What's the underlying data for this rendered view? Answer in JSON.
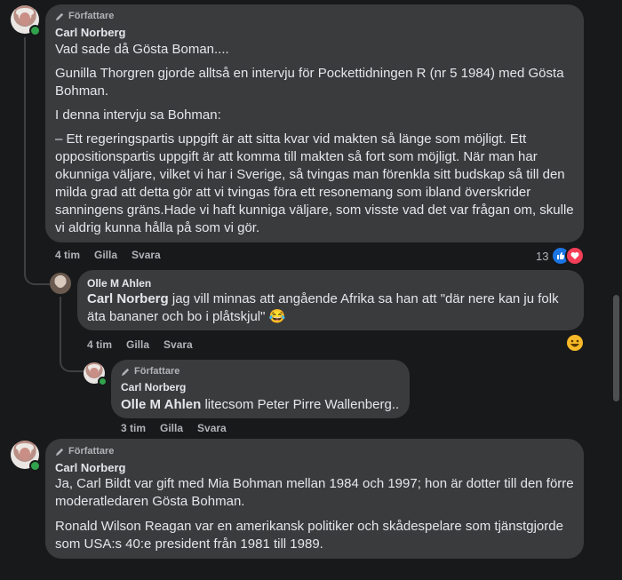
{
  "comments": [
    {
      "badge": "Författare",
      "author": "Carl Norberg",
      "paragraphs": [
        "Vad sade då Gösta Boman....",
        "Gunilla Thorgren gjorde alltså en intervju för Pockettidningen R (nr 5 1984) med Gösta Bohman.",
        "I denna intervju sa Bohman:",
        "– Ett regeringspartis uppgift är att sitta kvar vid makten så länge som möjligt. Ett oppositionspartis uppgift är att komma till makten så fort som möjligt. När man har okunniga väljare, vilket vi har i Sverige, så tvingas man förenkla sitt budskap så till den milda grad att detta gör att vi tvingas föra ett resonemang som ibland överskrider sanningens gräns.Hade vi haft kunniga väljare, som visste vad det var frågan om, skulle vi aldrig kunna hålla på som vi gör."
      ],
      "time": "4 tim",
      "like": "Gilla",
      "reply": "Svara",
      "reaction_count": "13"
    },
    {
      "author": "Olle M Ahlen",
      "mention": "Carl Norberg",
      "text": " jag vill minnas att angående Afrika sa han att \"där nere kan ju folk äta bananer och bo i plåtskjul\"",
      "time": "4 tim",
      "like": "Gilla",
      "reply": "Svara"
    },
    {
      "badge": "Författare",
      "author": "Carl Norberg",
      "mention": "Olle M Ahlen",
      "text": " litecsom Peter Pirre Wallenberg..",
      "time": "3 tim",
      "like": "Gilla",
      "reply": "Svara"
    },
    {
      "badge": "Författare",
      "author": "Carl Norberg",
      "paragraphs": [
        "Ja, Carl Bildt var gift med Mia Bohman mellan 1984 och 1997; hon är dotter till den förre moderatledaren Gösta Bohman.",
        "Ronald Wilson Reagan var en amerikansk politiker och skådespelare som tjänstgjorde som USA:s 40:e president från 1981 till 1989."
      ]
    }
  ],
  "colors": {
    "background": "#18191a",
    "bubble": "#3a3b3c",
    "like": "#1b74e4",
    "love": "#f33e58",
    "online": "#31a24c"
  },
  "icons": [
    "pencil-icon",
    "like-icon",
    "love-icon",
    "haha-icon"
  ]
}
